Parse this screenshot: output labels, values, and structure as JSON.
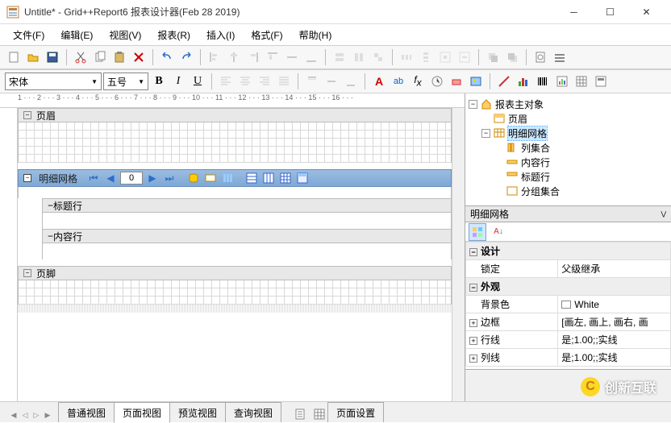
{
  "title": "Untitle* - Grid++Report6 报表设计器(Feb 28 2019)",
  "menu": [
    "文件(F)",
    "编辑(E)",
    "视图(V)",
    "报表(R)",
    "插入(I)",
    "格式(F)",
    "帮助(H)"
  ],
  "font": {
    "name": "宋体",
    "size": "五号"
  },
  "format": {
    "bold": "B",
    "italic": "I",
    "underline": "U"
  },
  "sections": {
    "header": "页眉",
    "detail": "明细网格",
    "titlerow": "标题行",
    "contentrow": "内容行",
    "footer": "页脚"
  },
  "detail_nav": {
    "value": "0"
  },
  "tabs": {
    "normal": "普通视图",
    "page": "页面视图",
    "preview": "预览视图",
    "query": "查询视图",
    "pagesetup": "页面设置"
  },
  "tree": {
    "root": "报表主对象",
    "i1": "页眉",
    "i2": "明细网格",
    "i2a": "列集合",
    "i2b": "内容行",
    "i2c": "标题行",
    "i2d": "分组集合"
  },
  "prop": {
    "title": "明细网格",
    "cat_design": "设计",
    "lock_k": "锁定",
    "lock_v": "父级继承",
    "cat_appearance": "外观",
    "bg_k": "背景色",
    "bg_v": "White",
    "border_k": "边框",
    "border_v": "[画左, 画上, 画右, 画",
    "rowline_k": "行线",
    "rowline_v": "是;1.00;;实线",
    "colline_k": "列线",
    "colline_v": "是;1.00;;实线"
  },
  "watermark": "创新互联",
  "ruler": "1 · · · 2 · · · 3 · · · 4 · · · 5 · · · 6 · · · 7 · · · 8 · · · 9 · · · 10 · · · 11 · · · 12 · · · 13 · · · 14 · · · 15 · · · 16 · · ·"
}
